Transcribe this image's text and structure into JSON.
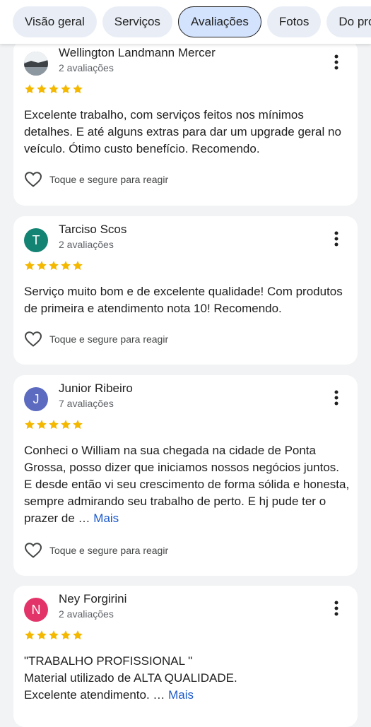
{
  "tabs": [
    {
      "label": "Visão geral",
      "active": false
    },
    {
      "label": "Serviços",
      "active": false
    },
    {
      "label": "Avaliações",
      "active": true
    },
    {
      "label": "Fotos",
      "active": false
    },
    {
      "label": "Do proprietário",
      "active": false
    }
  ],
  "react_label": "Toque e segure para reagir",
  "more_label": "Mais",
  "colors": {
    "star": "#f5b800",
    "link": "#1a58c9",
    "avatar_t": "#138373",
    "avatar_j": "#5c6bc0",
    "avatar_n": "#e33469"
  },
  "reviews": [
    {
      "name": "Wellington Landmann Mercer",
      "count": "2 avaliações",
      "avatar": "photo",
      "rating": 5,
      "text": "Excelente trabalho, com serviços feitos nos mínimos detalhes. E até alguns extras para dar um upgrade geral no veículo. Ótimo custo benefício. Recomendo.",
      "truncated": false
    },
    {
      "name": "Tarciso Scos",
      "count": "2 avaliações",
      "avatar": "T",
      "rating": 5,
      "text": "Serviço muito bom e de excelente qualidade! Com produtos de primeira e atendimento nota 10! Recomendo.",
      "truncated": false
    },
    {
      "name": "Junior Ribeiro",
      "count": "7 avaliações",
      "avatar": "J",
      "rating": 5,
      "text": "Conheci o William na sua chegada na cidade de Ponta Grossa, posso dizer que iniciamos nossos negócios juntos. E desde então vi seu crescimento de forma sólida e honesta, sempre admirando seu trabalho de perto. E hj pude ter o prazer de …",
      "truncated": true
    },
    {
      "name": "Ney Forgirini",
      "count": "2 avaliações",
      "avatar": "N",
      "rating": 5,
      "text_lines": [
        "\"TRABALHO PROFISSIONAL \"",
        "Material utilizado de ALTA QUALIDADE.",
        "Excelente atendimento. …"
      ],
      "truncated": true
    }
  ]
}
